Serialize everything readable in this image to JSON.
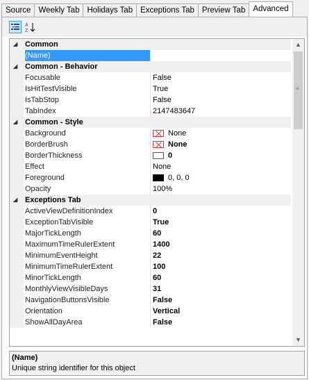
{
  "tabs": [
    {
      "label": "Source"
    },
    {
      "label": "Weekly Tab"
    },
    {
      "label": "Holidays Tab"
    },
    {
      "label": "Exceptions Tab"
    },
    {
      "label": "Preview Tab"
    },
    {
      "label": "Advanced"
    }
  ],
  "active_tab": "Advanced",
  "toolbar": {
    "categorized_icon": "categorized-icon",
    "alphabetical_icon": "sort-alphabetical-icon"
  },
  "categories": [
    {
      "label": "Common",
      "props": [
        {
          "name": "(Name)",
          "value": ""
        }
      ]
    },
    {
      "label": "Common - Behavior",
      "props": [
        {
          "name": "Focusable",
          "value": "False"
        },
        {
          "name": "IsHitTestVisible",
          "value": "True"
        },
        {
          "name": "IsTabStop",
          "value": "False"
        },
        {
          "name": "TabIndex",
          "value": "2147483647"
        }
      ]
    },
    {
      "label": "Common - Style",
      "props": [
        {
          "name": "Background",
          "value": "None"
        },
        {
          "name": "BorderBrush",
          "value": "None"
        },
        {
          "name": "BorderThickness",
          "value": "0"
        },
        {
          "name": "Effect",
          "value": "None"
        },
        {
          "name": "Foreground",
          "value": "0, 0, 0"
        },
        {
          "name": "Opacity",
          "value": "100%"
        }
      ]
    },
    {
      "label": "Exceptions Tab",
      "props": [
        {
          "name": "ActiveViewDefinitionIndex",
          "value": "0"
        },
        {
          "name": "ExceptionTabVisible",
          "value": "True"
        },
        {
          "name": "MajorTickLength",
          "value": "60"
        },
        {
          "name": "MaximumTimeRulerExtent",
          "value": "1400"
        },
        {
          "name": "MinimumEventHeight",
          "value": "22"
        },
        {
          "name": "MinimumTimeRulerExtent",
          "value": "100"
        },
        {
          "name": "MinorTickLength",
          "value": "60"
        },
        {
          "name": "MonthlyViewVisibleDays",
          "value": "31"
        },
        {
          "name": "NavigationButtonsVisible",
          "value": "False"
        },
        {
          "name": "Orientation",
          "value": "Vertical"
        },
        {
          "name": "ShowAllDayArea",
          "value": "False"
        }
      ]
    }
  ],
  "description": {
    "title": "(Name)",
    "text": "Unique string identifier for this object"
  },
  "scroll": {
    "thumb_position": 0
  }
}
